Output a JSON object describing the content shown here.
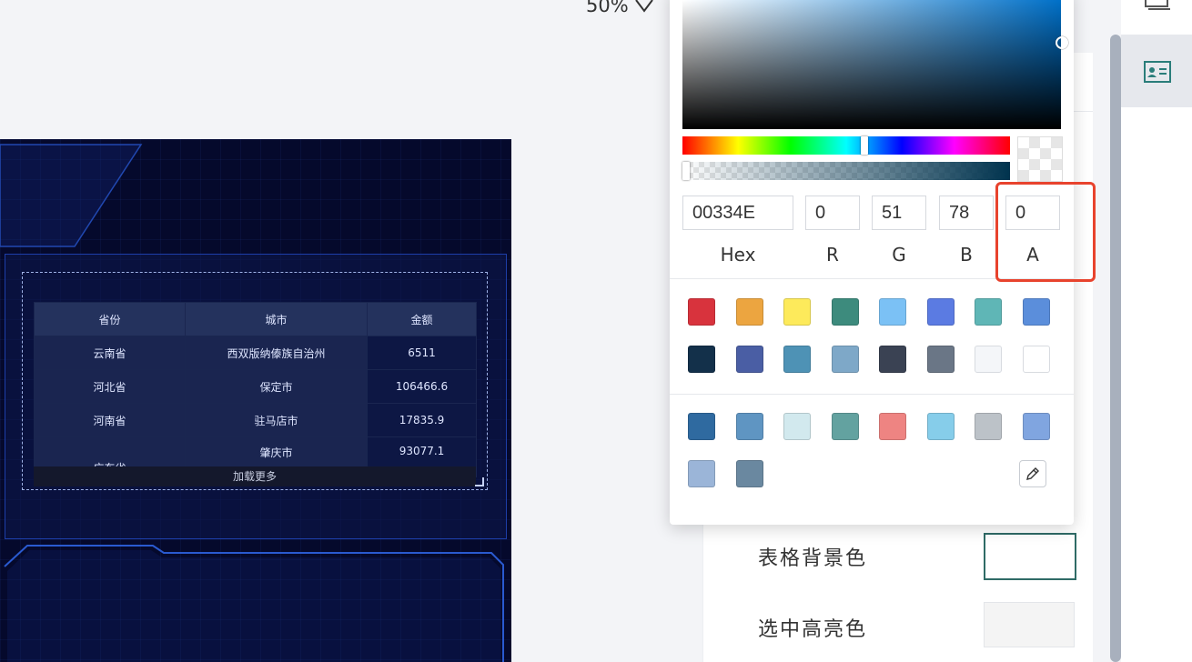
{
  "zoom": {
    "value": "50%"
  },
  "canvas": {
    "table": {
      "headers": [
        "省份",
        "城市",
        "金额"
      ],
      "rows": [
        {
          "province": "云南省",
          "city": "西双版纳傣族自治州",
          "amount": "6511"
        },
        {
          "province": "河北省",
          "city": "保定市",
          "amount": "106466.6"
        },
        {
          "province": "河南省",
          "city": "驻马店市",
          "amount": "17835.9"
        },
        {
          "province": "广东省",
          "city": "肇庆市",
          "amount": "93077.1"
        }
      ],
      "load_more": "加载更多"
    }
  },
  "picker": {
    "hex": "00334E",
    "r": "0",
    "g": "51",
    "b": "78",
    "a": "0",
    "labels": {
      "hex": "Hex",
      "r": "R",
      "g": "G",
      "b": "B",
      "a": "A"
    },
    "preset_colors_row1": [
      "#d8333d",
      "#eca540",
      "#fdea5b",
      "#3d8b7d",
      "#7bc1f5",
      "#5b7be2",
      "#5fb6b6",
      "#5b8edb"
    ],
    "preset_colors_row2": [
      "#13304a",
      "#4a5ea4",
      "#4e92b5",
      "#7ea8c8",
      "#3a4253",
      "#6a7686",
      "#f4f6f9",
      "#ffffff"
    ],
    "recent_colors_row1": [
      "#2f6aa0",
      "#5f95c2",
      "#d2e9ee",
      "#63a2a0",
      "#ee8482",
      "#86cdea",
      "#bcc2c8",
      "#80a5e0"
    ],
    "recent_colors_row2": [
      "#9bb5d8",
      "#6a88a0"
    ],
    "eyedropper_icon": "eyedropper-icon"
  },
  "settings": {
    "table_bg_label": "表格背景色",
    "highlight_label": "选中高亮色",
    "table_bg_color": "#ffffff",
    "highlight_color": "#f4f4f4"
  },
  "sidebar": {
    "icons": [
      "image-icon",
      "id-card-icon"
    ]
  }
}
